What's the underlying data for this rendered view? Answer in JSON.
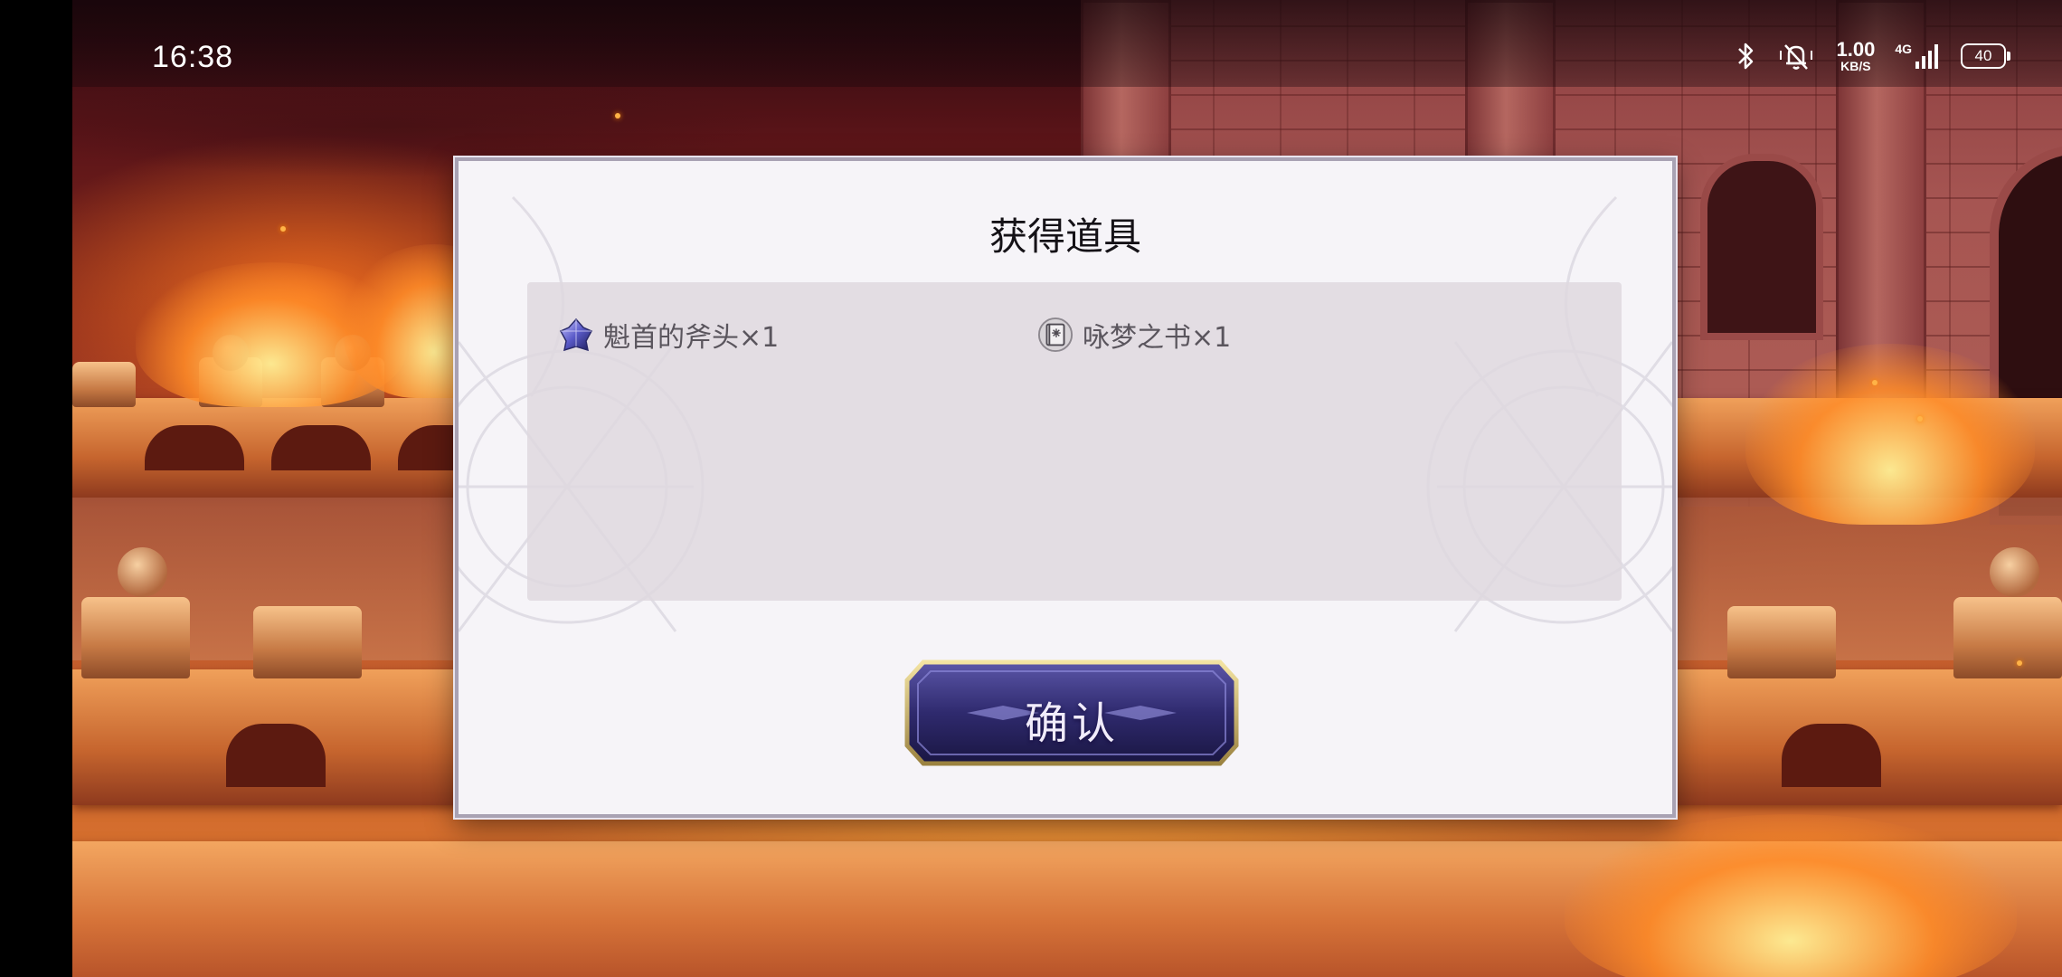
{
  "status_bar": {
    "time": "16:38",
    "net_speed_value": "1.00",
    "net_speed_unit": "KB/S",
    "network_type": "4G",
    "battery_level": "40",
    "icons": [
      "bluetooth-icon",
      "mute-bell-icon",
      "signal-icon",
      "battery-icon"
    ]
  },
  "dialog": {
    "title": "获得道具",
    "items": [
      {
        "name": "魁首的斧头×1",
        "icon": "crystal-axe-icon"
      },
      {
        "name": "咏梦之书×1",
        "icon": "book-icon"
      }
    ],
    "confirm_label": "确认"
  },
  "colors": {
    "dialog_bg": "#f6f4f8",
    "panel_bg": "#ded8de",
    "button_bg": "#3a3478",
    "button_border": "#c9b56a",
    "scene_fire": "#e07a2e"
  }
}
